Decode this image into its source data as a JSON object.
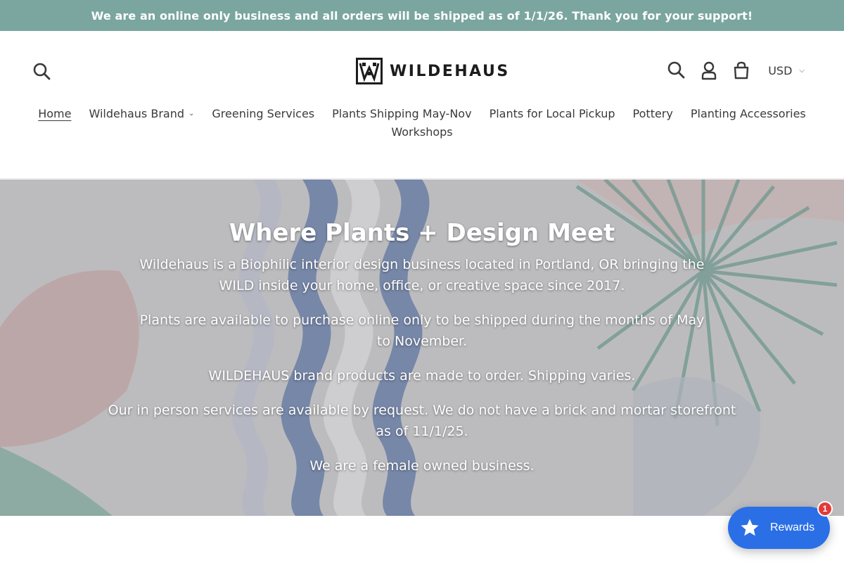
{
  "announcement": "We are an online only business and all orders will be shipped as of 1/1/26. Thank you for your support!",
  "brand": {
    "logo_text": "WILDEHAUS"
  },
  "header": {
    "currency": "USD",
    "icons": [
      "search-icon",
      "account-icon",
      "cart-icon"
    ]
  },
  "nav": {
    "items": [
      {
        "label": "Home",
        "active": true
      },
      {
        "label": "Wildehaus Brand",
        "has_dropdown": true
      },
      {
        "label": "Greening Services"
      },
      {
        "label": "Plants Shipping May-Nov"
      },
      {
        "label": "Plants for Local Pickup"
      },
      {
        "label": "Pottery"
      },
      {
        "label": "Planting Accessories"
      },
      {
        "label": "Workshops"
      }
    ]
  },
  "hero": {
    "title": "Where Plants + Design Meet",
    "paragraphs": [
      "Wildehaus is a Biophilic interior design business located in Portland, OR bringing the WILD inside your home, office, or creative space since 2017.",
      "Plants are available to purchase online only to be shipped during the months of May to November.",
      "WILDEHAUS brand products are made to order. Shipping varies.",
      "Our in person services are available by request. We do not have a brick and mortar storefront as of 11/1/25.",
      "We are a female owned business."
    ]
  },
  "rewards": {
    "label": "Rewards",
    "badge_count": "1",
    "color": "#2b6fe6"
  },
  "colors": {
    "announcement_bg": "#7aa69f",
    "badge": "#e23a3a"
  }
}
